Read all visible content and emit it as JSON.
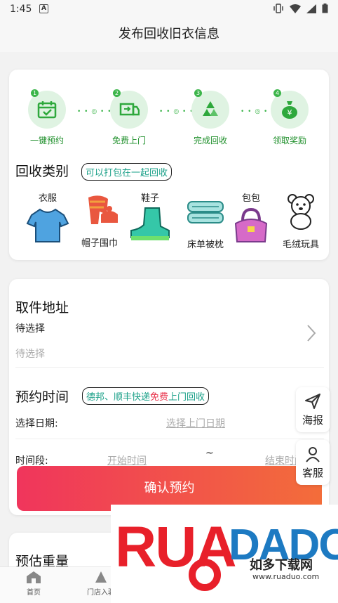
{
  "status": {
    "time": "1:45",
    "app_icon": "A"
  },
  "header": {
    "title": "发布回收旧衣信息"
  },
  "steps": [
    {
      "num": "1",
      "label": "一键预约",
      "icon": "calendar-check-icon"
    },
    {
      "num": "2",
      "label": "免费上门",
      "icon": "truck-icon"
    },
    {
      "num": "3",
      "label": "完成回收",
      "icon": "recycle-icon"
    },
    {
      "num": "4",
      "label": "领取奖励",
      "icon": "money-bag-icon"
    }
  ],
  "step_dots": "• • ◎ • •",
  "category": {
    "title": "回收类别",
    "tag": "可以打包在一起回收",
    "items": [
      {
        "label": "衣服",
        "icon": "shirt-icon"
      },
      {
        "label": "帽子围巾",
        "icon": "hat-scarf-icon"
      },
      {
        "label": "鞋子",
        "icon": "boot-icon"
      },
      {
        "label": "床单被枕",
        "icon": "bedding-icon"
      },
      {
        "label": "包包",
        "icon": "handbag-icon"
      },
      {
        "label": "毛绒玩具",
        "icon": "teddy-bear-icon"
      }
    ]
  },
  "pickup": {
    "title": "取件地址",
    "line1": "待选择",
    "line2": "待选择"
  },
  "booking": {
    "title": "预约时间",
    "tag_part1": "德邦、顺丰快递",
    "tag_part2": "免费",
    "tag_part3": "上门回收",
    "date_label": "选择日期:",
    "date_placeholder": "选择上门日期",
    "period_label": "时间段:",
    "start_placeholder": "开始时间",
    "tilde": "~",
    "end_placeholder": "结束时间"
  },
  "confirm_label": "确认预约",
  "float_buttons": {
    "poster": "海报",
    "service": "客服"
  },
  "weight": {
    "title": "预估重量"
  },
  "tabs": [
    {
      "label": "首页",
      "icon": "home-icon"
    },
    {
      "label": "门店入驻",
      "icon": "store-icon"
    }
  ],
  "watermark": {
    "brand": "RUADADO",
    "cn": "如多下载网",
    "url": "www.ruaduo.com"
  },
  "colors": {
    "green": "#3cb54a",
    "accent_red": "#f0355c",
    "accent_orange": "#f36d3a",
    "teal": "#1aa088"
  }
}
